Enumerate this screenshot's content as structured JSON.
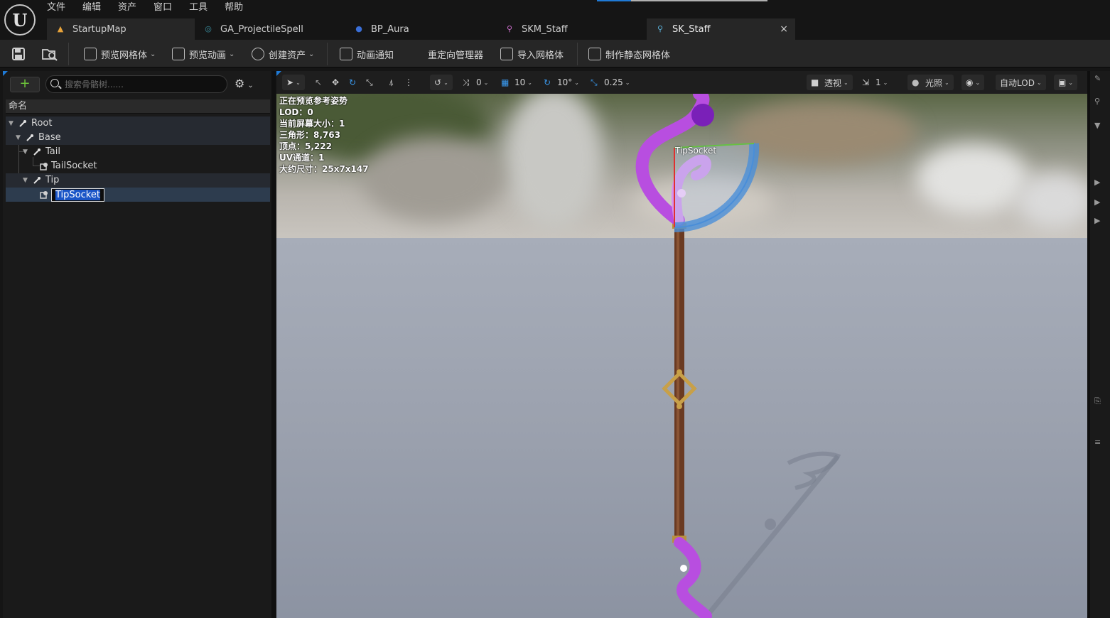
{
  "menubar": {
    "items": [
      "文件",
      "编辑",
      "资产",
      "窗口",
      "工具",
      "帮助"
    ]
  },
  "tabs": [
    {
      "label": "StartupMap",
      "icon": "map-icon"
    },
    {
      "label": "GA_ProjectileSpell",
      "icon": "gameplay-ability-icon"
    },
    {
      "label": "BP_Aura",
      "icon": "blueprint-icon"
    },
    {
      "label": "SKM_Staff",
      "icon": "skeletal-mesh-icon"
    },
    {
      "label": "SK_Staff",
      "icon": "skeleton-icon",
      "close": "×"
    }
  ],
  "toolbar": {
    "preview_mesh": "预览网格体",
    "preview_anim": "预览动画",
    "create_asset": "创建资产",
    "anim_notify": "动画通知",
    "retarget_manager": "重定向管理器",
    "import_mesh": "导入网格体",
    "make_static_mesh": "制作静态网格体"
  },
  "skeleton_tree": {
    "add_label": "+",
    "search_placeholder": "搜索骨骼树......",
    "column_header": "命名",
    "rows": [
      {
        "label": "Root",
        "type": "bone"
      },
      {
        "label": "Base",
        "type": "bone"
      },
      {
        "label": "Tail",
        "type": "bone"
      },
      {
        "label": "TailSocket",
        "type": "socket"
      },
      {
        "label": "Tip",
        "type": "bone"
      },
      {
        "label": "TipSocket",
        "type": "socket",
        "editing": true
      }
    ]
  },
  "viewport": {
    "translate_snap": "0",
    "grid_snap": "10",
    "rotate_snap": "10°",
    "scale_snap": "0.25",
    "view_mode": "透视",
    "camera_speed": "1",
    "lighting": "光照",
    "lod": "自动LOD",
    "socket_label": "TipSocket",
    "stats": [
      "正在预览参考姿势",
      "LOD：0",
      "当前屏幕大小：1",
      "三角形：8,763",
      "顶点：5,222",
      "UV通道：1",
      "大约尺寸：25x7x147"
    ]
  },
  "colors": {
    "accent": "#1f7ad6",
    "selection": "#1a55c7",
    "add_green": "#6dc53a",
    "staff_purple": "#b84ee0",
    "staff_wood": "#6a3a22",
    "gizmo_blue": "#4a8ed8"
  }
}
